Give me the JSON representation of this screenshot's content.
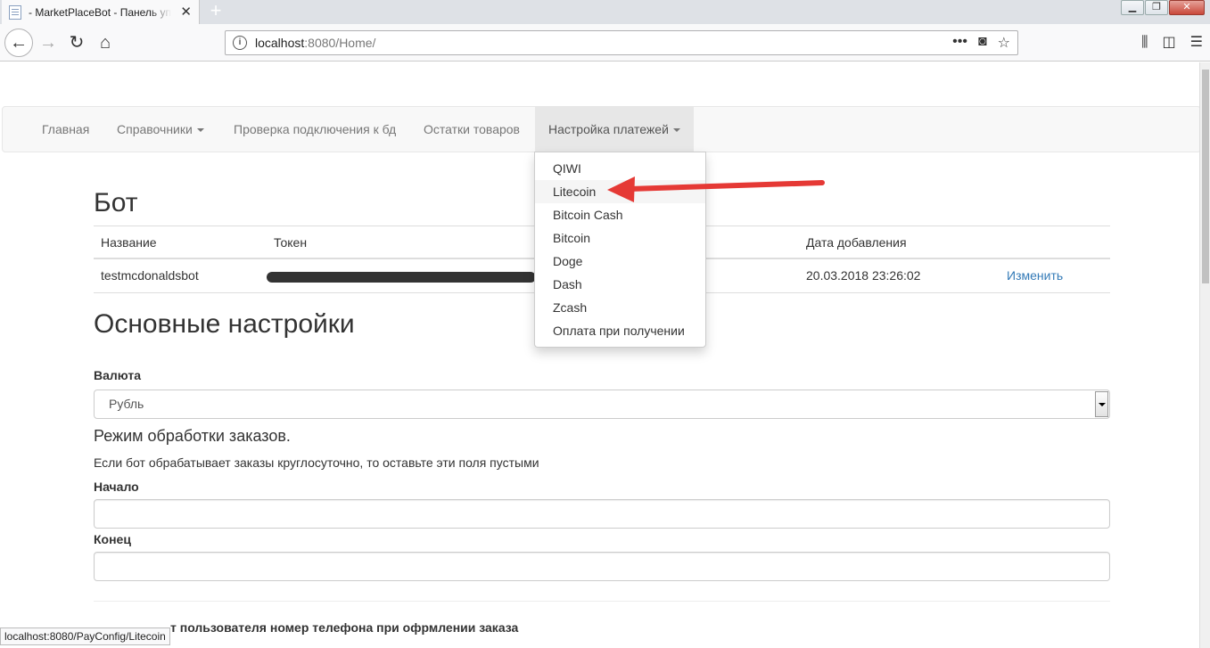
{
  "browser": {
    "tab_title": "- MarketPlaceBot - Панель упр",
    "url_host": "localhost",
    "url_rest": ":8080/Home/",
    "status_url": "localhost:8080/PayConfig/Litecoin"
  },
  "site_nav": {
    "items": [
      {
        "label": "Главная"
      },
      {
        "label": "Справочники"
      },
      {
        "label": "Проверка подключения к бд"
      },
      {
        "label": "Остатки товаров"
      },
      {
        "label": "Настройка платежей"
      }
    ]
  },
  "payments_menu": {
    "items": [
      "QIWI",
      "Litecoin",
      "Bitcoin Cash",
      "Bitcoin",
      "Doge",
      "Dash",
      "Zcash",
      "Оплата при получении"
    ],
    "highlighted": "Litecoin"
  },
  "bot_section": {
    "title": "Бот",
    "headers": {
      "name": "Название",
      "token": "Токен",
      "date": "Дата добавления"
    },
    "row": {
      "name": "testmcdonaldsbot",
      "date": "20.03.2018 23:26:02",
      "edit": "Изменить"
    }
  },
  "settings": {
    "title": "Основные настройки",
    "currency_label": "Валюта",
    "currency_value": "Рубль",
    "mode_title": "Режим обработки заказов.",
    "mode_help": "Если бот обрабатывает заказы круглосуточно, то оставьте эти поля пустыми",
    "start_label": "Начало",
    "end_label": "Конец",
    "start_value": "",
    "end_value": "",
    "phone_label_partial": "т пользователя номер телефона при офрмлении заказа"
  },
  "colors": {
    "link": "#337ab7",
    "annotation_arrow": "#e53935"
  }
}
